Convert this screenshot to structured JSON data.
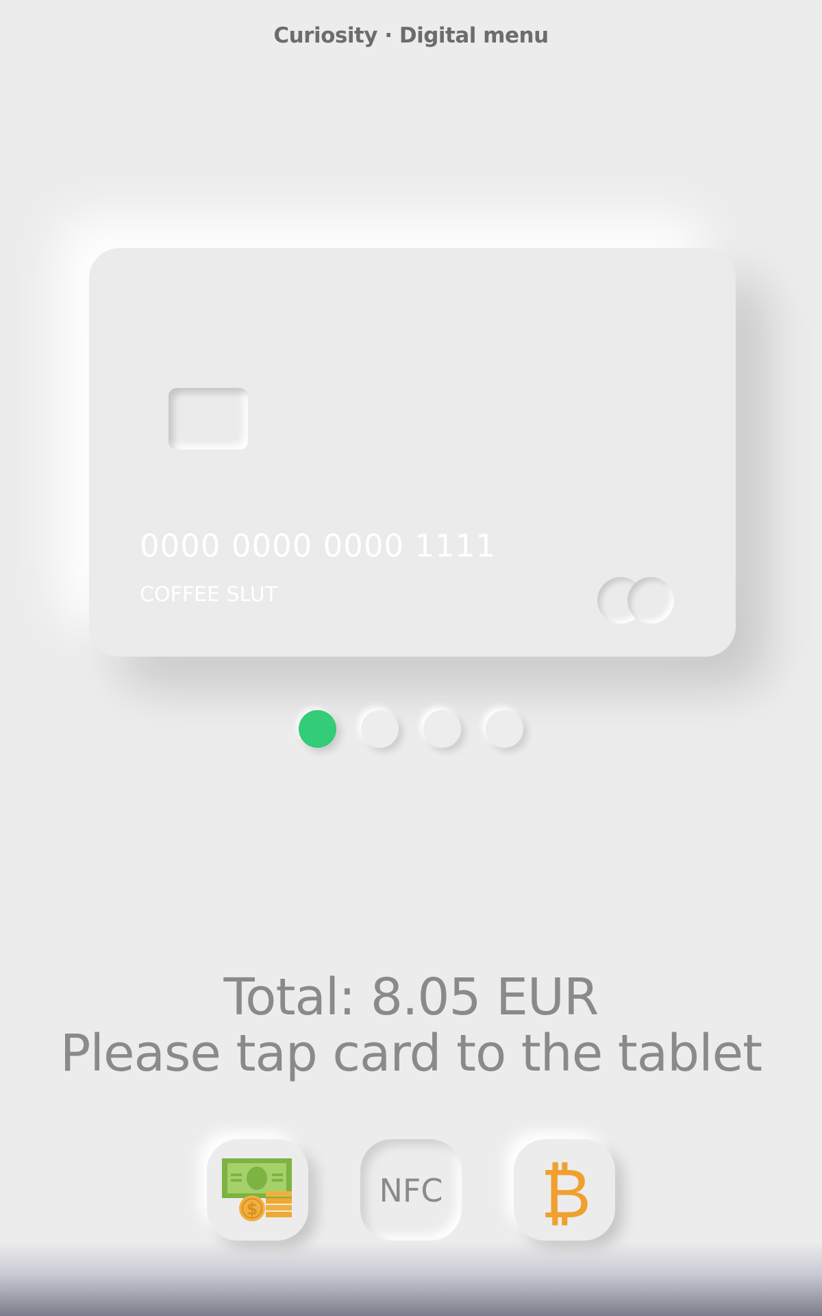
{
  "header": {
    "title": "Curiosity · Digital menu"
  },
  "card": {
    "number": "0000 0000 0000 1111",
    "holder": "COFFEE SLUT"
  },
  "carousel": {
    "dot_count": 4,
    "active_index": 0
  },
  "payment": {
    "total_text": "Total: 8.05 EUR",
    "instruction": "Please tap card to the tablet",
    "methods": [
      {
        "name": "cash",
        "icon": "cash-icon",
        "label": ""
      },
      {
        "name": "nfc",
        "icon": "nfc-icon",
        "label": "NFC"
      },
      {
        "name": "bitcoin",
        "icon": "bitcoin-icon",
        "label": "₿"
      }
    ]
  },
  "colors": {
    "background": "#ececec",
    "active_dot": "#33cc77",
    "text": "#8a8a8a",
    "header_text": "#6c6c6c",
    "cash_green": "#7cb342",
    "cash_light_green": "#a5d06a",
    "coin_orange": "#f0a830",
    "bitcoin_orange": "#f0a030"
  }
}
